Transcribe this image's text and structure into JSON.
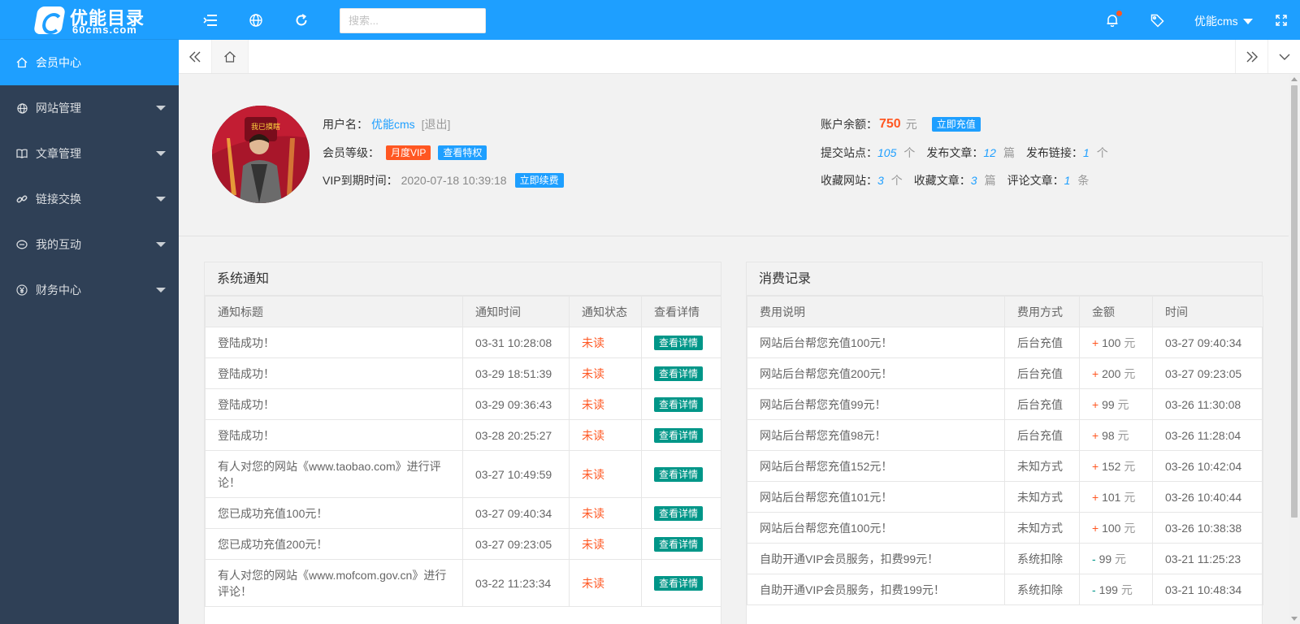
{
  "header": {
    "logo_title": "优能目录",
    "logo_sub": "60cms.com",
    "search_placeholder": "搜索...",
    "user_name": "优能cms",
    "icons": [
      "menu-toggle-icon",
      "globe-icon",
      "refresh-icon",
      "bell-icon",
      "tag-icon",
      "fullscreen-icon"
    ]
  },
  "sidebar": {
    "items": [
      {
        "label": "会员中心",
        "icon": "home-icon",
        "active": true
      },
      {
        "label": "网站管理",
        "icon": "globe-icon"
      },
      {
        "label": "文章管理",
        "icon": "book-icon"
      },
      {
        "label": "链接交换",
        "icon": "link-icon"
      },
      {
        "label": "我的互动",
        "icon": "chat-icon"
      },
      {
        "label": "财务中心",
        "icon": "yen-icon"
      }
    ]
  },
  "profile": {
    "username_label": "用户名：",
    "username": "优能cms",
    "logout": "[退出]",
    "level_label": "会员等级：",
    "level": "月度VIP",
    "privilege_btn": "查看特权",
    "vip_expire_label": "VIP到期时间：",
    "vip_expire": "2020-07-18 10:39:18",
    "renew_btn": "立即续费",
    "balance_label": "账户余额：",
    "balance": "750",
    "balance_unit": "元",
    "recharge_btn": "立即充值",
    "avatar_caption": "我已摸瞎",
    "stats": {
      "sites_label": "提交站点：",
      "sites": "105",
      "sites_unit": "个",
      "articles_label": "发布文章：",
      "articles": "12",
      "articles_unit": "篇",
      "links_label": "发布链接：",
      "links": "1",
      "links_unit": "个",
      "fav_sites_label": "收藏网站：",
      "fav_sites": "3",
      "fav_sites_unit": "个",
      "fav_articles_label": "收藏文章：",
      "fav_articles": "3",
      "fav_articles_unit": "篇",
      "comments_label": "评论文章：",
      "comments": "1",
      "comments_unit": "条"
    }
  },
  "notices": {
    "title": "系统通知",
    "columns": [
      "通知标题",
      "通知时间",
      "通知状态",
      "查看详情"
    ],
    "rows": [
      {
        "title": "登陆成功！",
        "time": "03-31 10:28:08",
        "status": "未读",
        "action": "查看详情"
      },
      {
        "title": "登陆成功！",
        "time": "03-29 18:51:39",
        "status": "未读",
        "action": "查看详情"
      },
      {
        "title": "登陆成功！",
        "time": "03-29 09:36:43",
        "status": "未读",
        "action": "查看详情"
      },
      {
        "title": "登陆成功！",
        "time": "03-28 20:25:27",
        "status": "未读",
        "action": "查看详情"
      },
      {
        "title": "有人对您的网站《www.taobao.com》进行评论！",
        "time": "03-27 10:49:59",
        "status": "未读",
        "action": "查看详情"
      },
      {
        "title": "您已成功充值100元！",
        "time": "03-27 09:40:34",
        "status": "未读",
        "action": "查看详情"
      },
      {
        "title": "您已成功充值200元！",
        "time": "03-27 09:23:05",
        "status": "未读",
        "action": "查看详情"
      },
      {
        "title": "有人对您的网站《www.mofcom.gov.cn》进行评论！",
        "time": "03-22 11:23:34",
        "status": "未读",
        "action": "查看详情"
      }
    ]
  },
  "records": {
    "title": "消费记录",
    "columns": [
      "费用说明",
      "费用方式",
      "金额",
      "时间"
    ],
    "rows": [
      {
        "desc": "网站后台帮您充值100元！",
        "method": "后台充值",
        "sign": "+",
        "amount": "100",
        "unit": "元",
        "time": "03-27 09:40:34"
      },
      {
        "desc": "网站后台帮您充值200元！",
        "method": "后台充值",
        "sign": "+",
        "amount": "200",
        "unit": "元",
        "time": "03-27 09:23:05"
      },
      {
        "desc": "网站后台帮您充值99元！",
        "method": "后台充值",
        "sign": "+",
        "amount": "99",
        "unit": "元",
        "time": "03-26 11:30:08"
      },
      {
        "desc": "网站后台帮您充值98元！",
        "method": "后台充值",
        "sign": "+",
        "amount": "98",
        "unit": "元",
        "time": "03-26 11:28:04"
      },
      {
        "desc": "网站后台帮您充值152元！",
        "method": "未知方式",
        "sign": "+",
        "amount": "152",
        "unit": "元",
        "time": "03-26 10:42:04"
      },
      {
        "desc": "网站后台帮您充值101元！",
        "method": "未知方式",
        "sign": "+",
        "amount": "101",
        "unit": "元",
        "time": "03-26 10:40:44"
      },
      {
        "desc": "网站后台帮您充值100元！",
        "method": "未知方式",
        "sign": "+",
        "amount": "100",
        "unit": "元",
        "time": "03-26 10:38:38"
      },
      {
        "desc": "自助开通VIP会员服务，扣费99元！",
        "method": "系统扣除",
        "sign": "-",
        "amount": "99",
        "unit": "元",
        "time": "03-21 11:25:23"
      },
      {
        "desc": "自助开通VIP会员服务，扣费199元！",
        "method": "系统扣除",
        "sign": "-",
        "amount": "199",
        "unit": "元",
        "time": "03-21 10:48:34"
      }
    ]
  },
  "colors": {
    "primary": "#1e9fff",
    "sidebar": "#2f4056",
    "accent": "#ff5722",
    "success": "#009688"
  }
}
